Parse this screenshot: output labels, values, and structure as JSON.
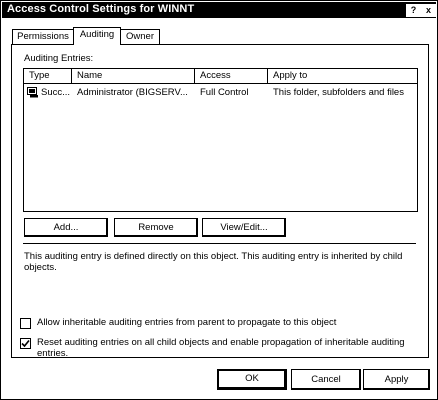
{
  "window": {
    "title": "Access Control Settings for WINNT",
    "help_button": "?",
    "close_button": "x"
  },
  "tabs": [
    {
      "label": "Permissions",
      "active": false
    },
    {
      "label": "Auditing",
      "active": true
    },
    {
      "label": "Owner",
      "active": false
    }
  ],
  "auditing": {
    "section_label": "Auditing Entries:",
    "columns": [
      "Type",
      "Name",
      "Access",
      "Apply to"
    ],
    "entries": [
      {
        "icon": "audit-entry-icon",
        "type": "Succ...",
        "name": "Administrator (BIGSERV...",
        "access": "Full Control",
        "apply_to": "This folder, subfolders and files"
      }
    ],
    "buttons": {
      "add": "Add...",
      "remove": "Remove",
      "view_edit": "View/Edit..."
    },
    "description": "This auditing entry is defined directly on this object. This auditing entry is inherited by child objects.",
    "checkboxes": [
      {
        "label": "Allow inheritable auditing entries from parent to propagate to this object",
        "checked": false
      },
      {
        "label": "Reset auditing entries on all child objects and enable propagation of inheritable auditing entries.",
        "checked": true
      }
    ]
  },
  "footer": {
    "ok": "OK",
    "cancel": "Cancel",
    "apply": "Apply"
  }
}
